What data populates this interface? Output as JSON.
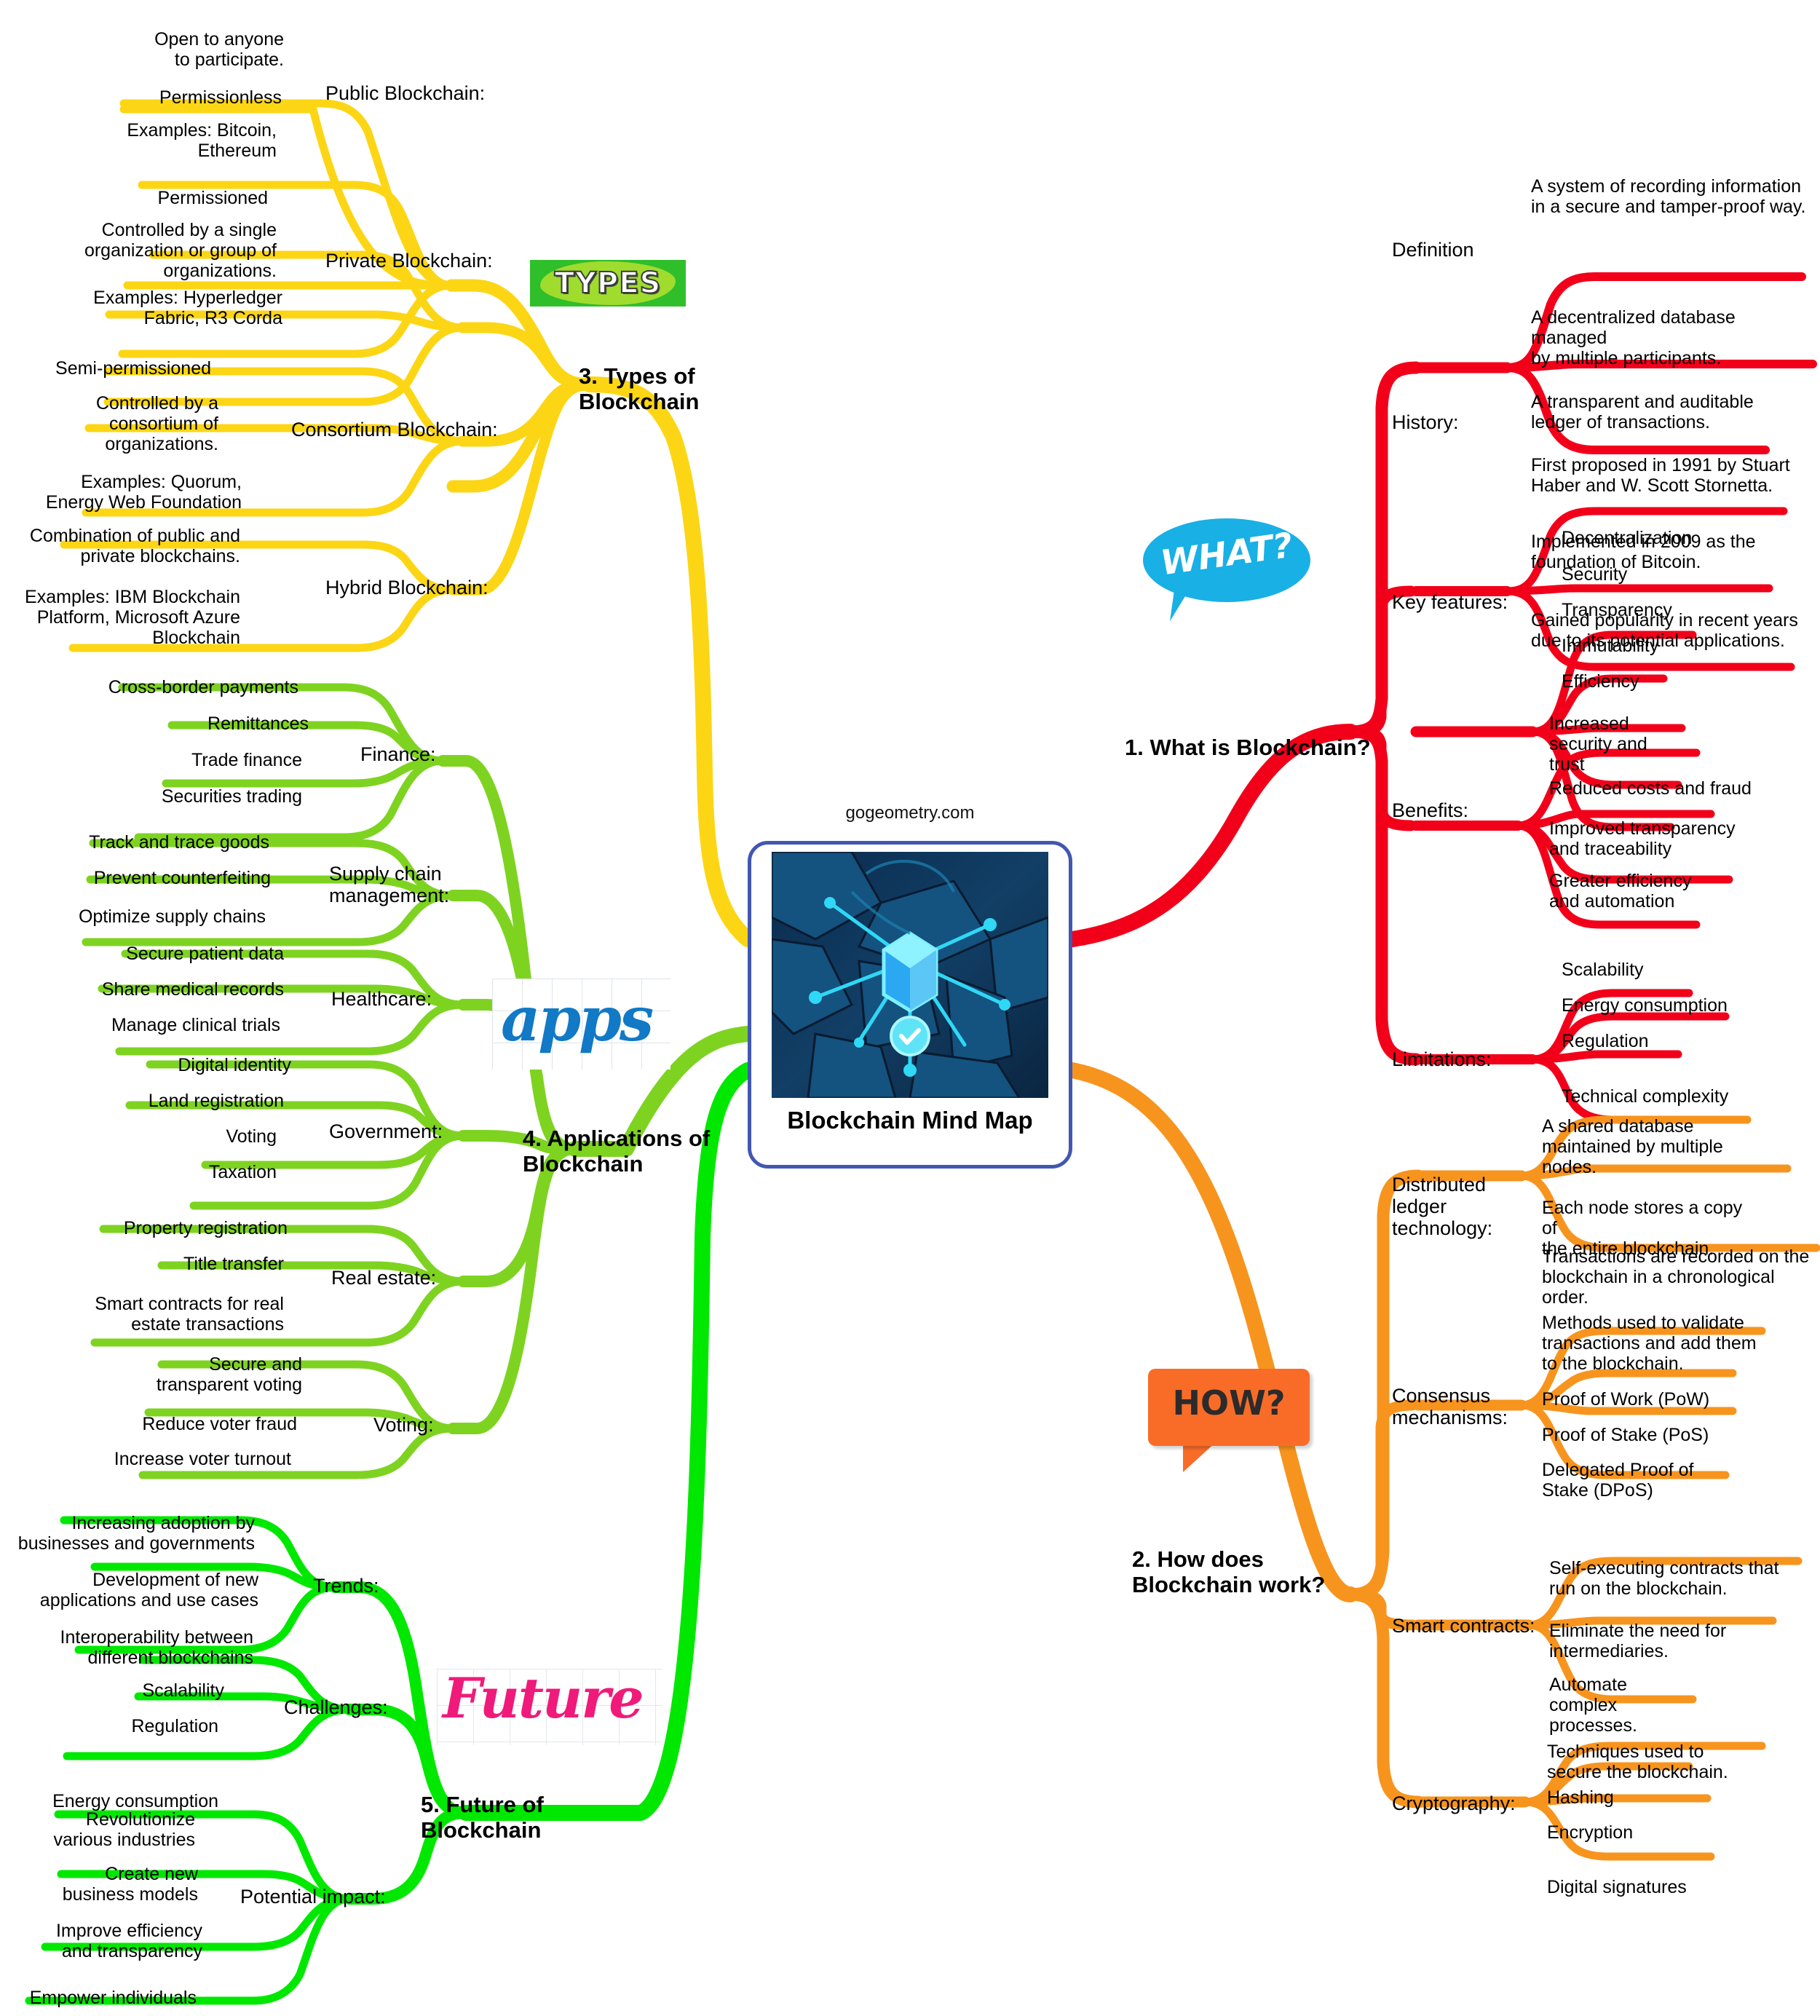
{
  "center": {
    "credit": "gogeometry.com",
    "title": "Blockchain\nMind Map",
    "thumb_alt": "blockchain-network-illustration"
  },
  "decorations": {
    "types_word": "TYPES",
    "apps_word": "apps",
    "future_word": "Future"
  },
  "bubbles": {
    "what": "WHAT?",
    "how": "HOW?"
  },
  "colors": {
    "red": "#f2001a",
    "orange": "#f7941e",
    "yellow": "#fcd615",
    "yellow_green": "#7ed321",
    "green": "#00e800",
    "center_border": "#4257b2",
    "bubble_what": "#19b0e5",
    "bubble_how": "#f96c28"
  },
  "branches": [
    {
      "id": "what-is-blockchain",
      "label": "1. What is Blockchain?",
      "color": "#f2001a",
      "subs": [
        {
          "label": "Definition",
          "leaves": [
            "A system of recording information\nin a secure and tamper-proof way.",
            "A decentralized database managed\nby multiple participants.",
            "A transparent and auditable\nledger of transactions."
          ]
        },
        {
          "label": "History:",
          "leaves": [
            "First proposed in 1991 by Stuart\nHaber and W. Scott Stornetta.",
            "Implemented in 2009 as the\nfoundation of Bitcoin.",
            "Gained popularity in recent years\ndue to its potential applications."
          ]
        },
        {
          "label": "Key features:",
          "leaves": [
            "Decentralization",
            "Security",
            "Transparency",
            "Immutability",
            "Efficiency"
          ]
        },
        {
          "label": "Benefits:",
          "leaves": [
            "Increased\nsecurity and\ntrust",
            "Reduced costs and fraud",
            "Improved transparency\nand traceability",
            "Greater efficiency\nand automation"
          ]
        },
        {
          "label": "Limitations:",
          "leaves": [
            "Scalability",
            "Energy consumption",
            "Regulation",
            "Technical complexity"
          ]
        }
      ]
    },
    {
      "id": "how-does-blockchain-work",
      "label": "2. How does\nBlockchain work?",
      "color": "#f7941e",
      "subs": [
        {
          "label": "Distributed\nledger\ntechnology:",
          "leaves": [
            "A shared database\nmaintained by multiple\nnodes.",
            "Each node stores a copy of\nthe entire blockchain.",
            "Transactions are recorded on the\nblockchain in a chronological order."
          ]
        },
        {
          "label": "Consensus\nmechanisms:",
          "leaves": [
            "Methods used to validate\ntransactions and add them\nto the blockchain.",
            "Proof of Work (PoW)",
            "Proof of Stake (PoS)",
            "Delegated Proof of\nStake (DPoS)"
          ]
        },
        {
          "label": "Smart contracts:",
          "leaves": [
            "Self-executing contracts that\nrun on the blockchain.",
            "Eliminate the need for\nintermediaries.",
            "Automate\ncomplex\nprocesses."
          ]
        },
        {
          "label": "Cryptography:",
          "leaves": [
            "Techniques used to\nsecure the blockchain.",
            "Hashing",
            "Encryption",
            "Digital signatures"
          ]
        }
      ]
    },
    {
      "id": "types-of-blockchain",
      "label": "3. Types of\nBlockchain",
      "color": "#fcd615",
      "subs": [
        {
          "label": "Public Blockchain:",
          "leaves": [
            "Open to anyone\nto participate.",
            "Permissionless",
            "Examples: Bitcoin,\nEthereum"
          ]
        },
        {
          "label": "Private Blockchain:",
          "leaves": [
            "Permissioned",
            "Controlled by a single\norganization or group of\norganizations.",
            "Examples: Hyperledger\nFabric, R3 Corda"
          ]
        },
        {
          "label": "Consortium Blockchain:",
          "leaves": [
            "Semi-permissioned",
            "Controlled by a\nconsortium of\norganizations.",
            "Examples: Quorum,\nEnergy Web Foundation"
          ]
        },
        {
          "label": "Hybrid Blockchain:",
          "leaves": [
            "Combination of public and\nprivate blockchains.",
            "Examples: IBM Blockchain\nPlatform, Microsoft Azure\nBlockchain"
          ]
        }
      ]
    },
    {
      "id": "applications-of-blockchain",
      "label": "4. Applications of\nBlockchain",
      "color": "#7ed321",
      "subs": [
        {
          "label": "Finance:",
          "leaves": [
            "Cross-border payments",
            "Remittances",
            "Trade finance",
            "Securities trading"
          ]
        },
        {
          "label": "Supply chain\nmanagement:",
          "leaves": [
            "Track and trace goods",
            "Prevent counterfeiting",
            "Optimize supply chains"
          ]
        },
        {
          "label": "Healthcare:",
          "leaves": [
            "Secure patient data",
            "Share medical records",
            "Manage clinical trials"
          ]
        },
        {
          "label": "Government:",
          "leaves": [
            "Digital identity",
            "Land registration",
            "Voting",
            "Taxation"
          ]
        },
        {
          "label": "Real estate:",
          "leaves": [
            "Property registration",
            "Title transfer",
            "Smart contracts for real\nestate transactions"
          ]
        },
        {
          "label": "Voting:",
          "leaves": [
            "Secure and\ntransparent voting",
            "Reduce voter fraud",
            "Increase voter turnout"
          ]
        }
      ]
    },
    {
      "id": "future-of-blockchain",
      "label": "5. Future of\nBlockchain",
      "color": "#00e800",
      "subs": [
        {
          "label": "Trends:",
          "leaves": [
            "Increasing adoption by\nbusinesses and governments",
            "Development of new\napplications and use cases",
            "Interoperability between\ndifferent blockchains"
          ]
        },
        {
          "label": "Challenges:",
          "leaves": [
            "Scalability",
            "Regulation",
            "Energy consumption"
          ]
        },
        {
          "label": "Potential impact:",
          "leaves": [
            "Revolutionize\nvarious industries",
            "Create new\nbusiness models",
            "Improve efficiency\nand transparency",
            "Empower individuals"
          ]
        }
      ]
    }
  ]
}
